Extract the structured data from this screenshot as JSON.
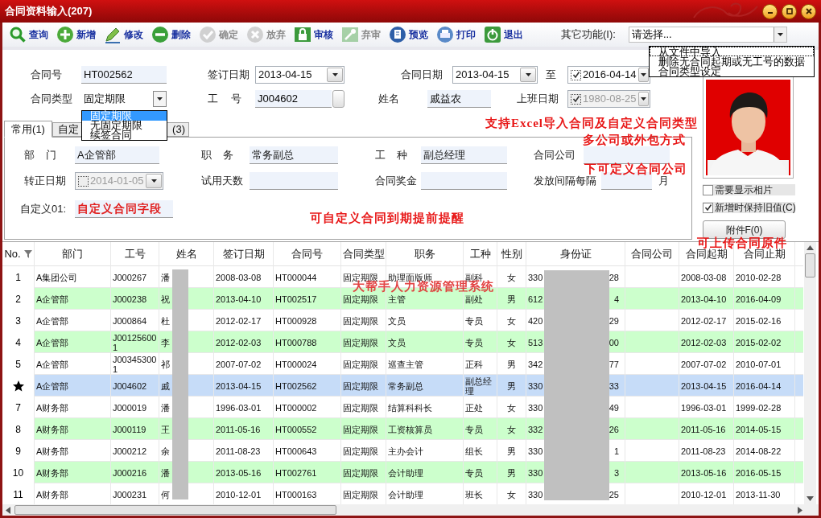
{
  "window": {
    "title": "合同资料输入(207)"
  },
  "toolbar": {
    "buttons": [
      {
        "kind": "search",
        "label": "查询",
        "disabled": false
      },
      {
        "kind": "add",
        "label": "新增",
        "disabled": false
      },
      {
        "kind": "edit",
        "label": "修改",
        "disabled": false
      },
      {
        "kind": "delete",
        "label": "删除",
        "disabled": false
      },
      {
        "kind": "confirm",
        "label": "确定",
        "disabled": true
      },
      {
        "kind": "cancel",
        "label": "放弃",
        "disabled": true
      },
      {
        "kind": "approve",
        "label": "审核",
        "disabled": false
      },
      {
        "kind": "unapprove",
        "label": "弃审",
        "disabled": true
      },
      {
        "kind": "preview",
        "label": "预览",
        "disabled": false
      },
      {
        "kind": "print",
        "label": "打印",
        "disabled": false
      },
      {
        "kind": "exit",
        "label": "退出",
        "disabled": false
      }
    ],
    "other_functions": {
      "label": "其它功能(I):",
      "value": "请选择...",
      "menu": [
        {
          "label": "从文件中导入",
          "selected": true
        },
        {
          "label": "删除无合同起期或无工号的数据",
          "selected": false
        },
        {
          "label": "合同类型设定",
          "selected": false
        }
      ]
    }
  },
  "form": {
    "rows": [
      [
        {
          "label": "合同号",
          "kind": "text",
          "value": "HT002562"
        },
        {
          "label": "签订日期",
          "kind": "date",
          "value": "2013-04-15",
          "disabled": false
        },
        {
          "label": "合同日期",
          "kind": "date",
          "value": "2013-04-15",
          "disabled": false
        },
        {
          "label": "至",
          "kind": "date",
          "value": "2016-04-14",
          "checked": true,
          "disabled": false
        }
      ],
      [
        {
          "label": "合同类型",
          "kind": "combo",
          "value": "固定期限",
          "options": [
            {
              "label": "固定期限",
              "selected": true
            },
            {
              "label": "无固定期限",
              "selected": false
            },
            {
              "label": "续签合同",
              "selected": false
            }
          ]
        },
        {
          "label": "工 号",
          "kind": "lookup",
          "value": "J004602"
        },
        {
          "label": "姓名",
          "kind": "text",
          "value": "戚益农"
        },
        {
          "label": "上班日期",
          "kind": "date",
          "value": "1980-08-25",
          "checked": true,
          "disabled": true
        }
      ]
    ]
  },
  "tabs": [
    {
      "label": "常用(1)",
      "selected": true
    },
    {
      "label": "自定",
      "selected": false
    },
    {
      "label": "(3)",
      "selected": false
    }
  ],
  "tab_panel": {
    "rows": [
      [
        {
          "label": "部 门",
          "kind": "text",
          "value": "A企管部"
        },
        {
          "label": "职 务",
          "kind": "text",
          "value": "常务副总"
        },
        {
          "label": "工 种",
          "kind": "text",
          "value": "副总经理"
        },
        {
          "label": "合同公司",
          "kind": "text"
        }
      ],
      [
        {
          "label": "转正日期",
          "kind": "date",
          "value": "2014-01-05",
          "checked": false,
          "disabled": true
        },
        {
          "label": "试用天数",
          "kind": "text"
        },
        {
          "label": "合同奖金",
          "kind": "text"
        },
        {
          "label": "发放间隔每隔",
          "kind": "text",
          "unit": "月"
        }
      ],
      [
        {
          "label": "自定义01:",
          "kind": "note",
          "value": "自定义合同字段"
        }
      ]
    ]
  },
  "photo_panel": {
    "show_photo": {
      "label": "需要显示相片",
      "checked": false
    },
    "keep_values": {
      "label": "新增时保持旧值(C)",
      "checked": true
    },
    "attachment_button": "附件F(0)"
  },
  "table": {
    "columns": [
      "No.",
      "部门",
      "工号",
      "姓名",
      "签订日期",
      "合同号",
      "合同类型",
      "职务",
      "工种",
      "性别",
      "身份证",
      "合同公司",
      "合同起期",
      "合同止期"
    ],
    "rows": [
      {
        "no": "1",
        "department": "A集团公司",
        "employee_no": "J000267",
        "name": "潘",
        "signed": "2008-03-08",
        "contract_no": "HT000044",
        "contract_type": "固定期限",
        "position": "助理面版师",
        "grade": "副科",
        "gender": "女",
        "id_start": "330",
        "id_end": "28",
        "start": "2008-03-08",
        "end": "2010-02-28",
        "selected": false
      },
      {
        "no": "2",
        "department": "A企管部",
        "employee_no": "J000238",
        "name": "祝",
        "signed": "2013-04-10",
        "contract_no": "HT002517",
        "contract_type": "固定期限",
        "position": "主管",
        "grade": "副处",
        "gender": "男",
        "id_start": "612",
        "id_end": "4",
        "start": "2013-04-10",
        "end": "2016-04-09",
        "selected": false
      },
      {
        "no": "3",
        "department": "A企管部",
        "employee_no": "J000864",
        "name": "杜",
        "signed": "2012-02-17",
        "contract_no": "HT000928",
        "contract_type": "固定期限",
        "position": "文员",
        "grade": "专员",
        "gender": "女",
        "id_start": "420",
        "id_end": "29",
        "start": "2012-02-17",
        "end": "2015-02-16",
        "selected": false
      },
      {
        "no": "4",
        "department": "A企管部",
        "employee_no": "J001256001",
        "name": "李",
        "signed": "2012-02-03",
        "contract_no": "HT000788",
        "contract_type": "固定期限",
        "position": "文员",
        "grade": "专员",
        "gender": "女",
        "id_start": "513",
        "id_end": "00",
        "start": "2012-02-03",
        "end": "2015-02-02",
        "selected": false
      },
      {
        "no": "5",
        "department": "A企管部",
        "employee_no": "J003453001",
        "name": "祁",
        "signed": "2007-07-02",
        "contract_no": "HT000024",
        "contract_type": "固定期限",
        "position": "巡查主管",
        "grade": "正科",
        "gender": "男",
        "id_start": "342",
        "id_end": "77",
        "start": "2007-07-02",
        "end": "2010-07-01",
        "selected": false
      },
      {
        "department": "A企管部",
        "employee_no": "J004602",
        "name": "戚",
        "signed": "2013-04-15",
        "contract_no": "HT002562",
        "contract_type": "固定期限",
        "position": "常务副总",
        "grade": "副总经理",
        "gender": "男",
        "id_start": "330",
        "id_end": "33",
        "start": "2013-04-15",
        "end": "2016-04-14",
        "selected": true
      },
      {
        "no": "7",
        "department": "A财务部",
        "employee_no": "J000019",
        "name": "潘",
        "signed": "1996-03-01",
        "contract_no": "HT000002",
        "contract_type": "固定期限",
        "position": "结算科科长",
        "grade": "正处",
        "gender": "女",
        "id_start": "330",
        "id_end": "49",
        "start": "1996-03-01",
        "end": "1999-02-28",
        "selected": false
      },
      {
        "no": "8",
        "department": "A财务部",
        "employee_no": "J000119",
        "name": "王",
        "signed": "2011-05-16",
        "contract_no": "HT000552",
        "contract_type": "固定期限",
        "position": "工资核算员",
        "grade": "专员",
        "gender": "女",
        "id_start": "332",
        "id_end": "26",
        "start": "2011-05-16",
        "end": "2014-05-15",
        "selected": false
      },
      {
        "no": "9",
        "department": "A财务部",
        "employee_no": "J000212",
        "name": "余",
        "signed": "2011-08-23",
        "contract_no": "HT000643",
        "contract_type": "固定期限",
        "position": "主办会计",
        "grade": "组长",
        "gender": "男",
        "id_start": "330",
        "id_end": "1",
        "start": "2011-08-23",
        "end": "2014-08-22",
        "selected": false
      },
      {
        "no": "10",
        "department": "A财务部",
        "employee_no": "J000216",
        "name": "潘",
        "signed": "2013-05-16",
        "contract_no": "HT002761",
        "contract_type": "固定期限",
        "position": "会计助理",
        "grade": "专员",
        "gender": "男",
        "id_start": "330",
        "id_end": "3",
        "start": "2013-05-16",
        "end": "2016-05-15",
        "selected": false
      },
      {
        "no": "11",
        "department": "A财务部",
        "employee_no": "J000231",
        "name": "何",
        "signed": "2010-12-01",
        "contract_no": "HT000163",
        "contract_type": "固定期限",
        "position": "会计助理",
        "grade": "班长",
        "gender": "女",
        "id_start": "330",
        "id_end": "25",
        "start": "2010-12-01",
        "end": "2013-11-30",
        "selected": false
      }
    ]
  },
  "annotations": [
    "支持Excel导入合同及自定义合同类型",
    "多公司或外包方式",
    "下可定义合同公司",
    "可自定义合同到期提前提醒",
    "可上传合同原件",
    "大帮手人力资源管理系统"
  ]
}
